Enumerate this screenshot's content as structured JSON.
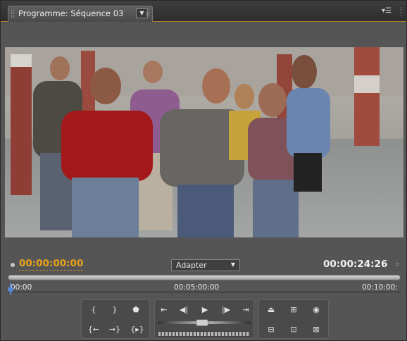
{
  "panel": {
    "tab_title": "Programme: Séquence 03",
    "tab_menu_glyph": "▼",
    "close_glyph": "×",
    "panel_menu_glyph": "▾☰"
  },
  "timecode": {
    "current": "00:00:00:00",
    "duration": "00:00:24:26"
  },
  "fit": {
    "value": "Adapter",
    "arrow": "▼"
  },
  "ruler": {
    "labels": [
      "00:00",
      "00:05:00:00",
      "00:10:00:"
    ],
    "playhead_position_fraction": 0.0
  },
  "controls": {
    "mark_in": "{",
    "mark_out": "}",
    "add_marker": "⬟",
    "go_to_in": "{←",
    "go_to_out": "→}",
    "play_in_to_out": "{▸}",
    "go_previous_edit": "⇤",
    "step_back": "◀|",
    "play": "▶",
    "step_forward": "|▶",
    "go_next_edit": "⇥",
    "lift": "⏏",
    "extract": "⊞",
    "output": "◉",
    "trim_monitor": "⊟",
    "export_frame": "⊡",
    "multi_camera": "⊠"
  },
  "colors": {
    "current_timecode": "#e7a21b",
    "duration_timecode": "#f2f2f2",
    "playhead": "#5a86d8",
    "panel_accent_line": "#a8802a"
  }
}
